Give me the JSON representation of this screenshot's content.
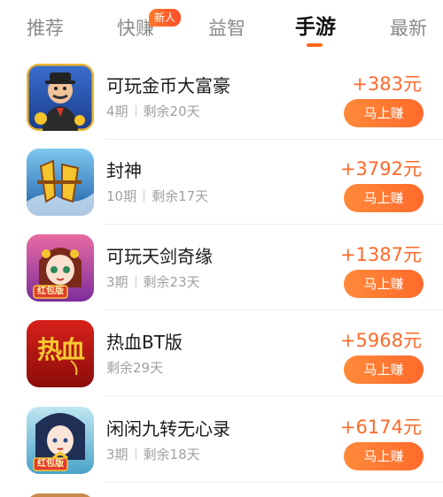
{
  "tabs": [
    {
      "label": "推荐"
    },
    {
      "label": "快赚"
    },
    {
      "label": "益智"
    },
    {
      "label": "手游"
    },
    {
      "label": "最新"
    }
  ],
  "tabs_new_badge": "新人",
  "active_tab": "手游",
  "colors": {
    "accent": "#ff6a2b",
    "tab_inactive": "#8a8a8a",
    "meta_text": "#a0a0a0"
  },
  "games": [
    {
      "name": "可玩金币大富豪",
      "period": "4期",
      "remaining": "剩余20天",
      "reward": "+383元",
      "button": "马上赚",
      "icon": "tycoon-game-icon"
    },
    {
      "name": "封神",
      "period": "10期",
      "remaining": "剩余17天",
      "reward": "+3792元",
      "button": "马上赚",
      "icon": "fengshen-game-icon"
    },
    {
      "name": "可玩天剑奇缘",
      "period": "3期",
      "remaining": "剩余23天",
      "reward": "+1387元",
      "button": "马上赚",
      "icon": "tianjian-game-icon",
      "icon_text": "红包版"
    },
    {
      "name": "热血BT版",
      "period": "",
      "remaining": "剩余29天",
      "reward": "+5968元",
      "button": "马上赚",
      "icon": "rexue-game-icon",
      "icon_text": "热血"
    },
    {
      "name": "闲闲九转无心录",
      "period": "3期",
      "remaining": "剩余18天",
      "reward": "+6174元",
      "button": "马上赚",
      "icon": "jiuzhuan-game-icon",
      "icon_text": "红包版"
    }
  ]
}
